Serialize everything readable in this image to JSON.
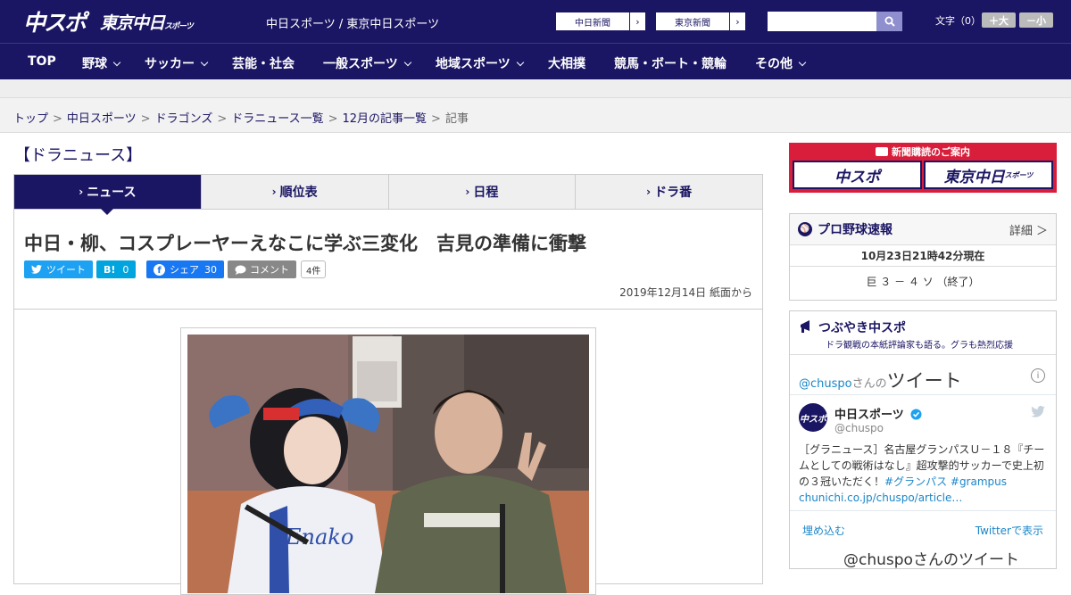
{
  "header": {
    "logo_chuspo": "中スポ",
    "logo_tokyo": "東京中日",
    "logo_tokyo_small": "スポーツ",
    "site_title": "中日スポーツ / 東京中日スポーツ",
    "btn_chunichi": "中日新聞",
    "btn_tokyo": "東京新聞",
    "search_placeholder": "",
    "font_size_label": "文字（0）",
    "font_bigger": "＋大",
    "font_smaller": "－小"
  },
  "nav": {
    "items": [
      {
        "label": "TOP"
      },
      {
        "label": "野球"
      },
      {
        "label": "サッカー"
      },
      {
        "label": "芸能・社会"
      },
      {
        "label": "一般スポーツ"
      },
      {
        "label": "地域スポーツ"
      },
      {
        "label": "大相撲"
      },
      {
        "label": "競馬・ボート・競輪"
      },
      {
        "label": "その他"
      }
    ]
  },
  "breadcrumb": [
    "トップ",
    "中日スポーツ",
    "ドラゴンズ",
    "ドラニュース一覧",
    "12月の記事一覧",
    "記事"
  ],
  "section_title": "【ドラニュース】",
  "tabs": [
    "ニュース",
    "順位表",
    "日程",
    "ドラ番"
  ],
  "article": {
    "headline": "中日・柳、コスプレーヤーえなこに学ぶ三変化　吉見の準備に衝撃",
    "share": {
      "tweet": "ツイート",
      "hatena_label": "B!",
      "hatena_count": "0",
      "fb_share": "シェア",
      "fb_count": "30",
      "comment": "コメント",
      "comment_count": "4件"
    },
    "date": "2019年12月14日 紙面から"
  },
  "sidebar": {
    "ad_title": "新聞購読のご案内",
    "ad_chuspo": "中スポ",
    "ad_tokyo": "東京中日",
    "ad_tokyo_small": "スポーツ",
    "baseball": {
      "title": "プロ野球速報",
      "detail": "詳細 ＞",
      "time": "10月23日21時42分現在",
      "score": "巨 ３ － ４ ソ （終了）"
    },
    "tsubuyaki": {
      "title": "つぶやき中スポ",
      "subtitle": "ドラ観戦の本紙評論家も語る。グラも熱烈応援",
      "handle": "@chuspo",
      "handle_suffix": "さんの",
      "tweet_word": "ツイート",
      "avatar_text": "中スポ",
      "account_name": "中日スポーツ",
      "screen_name": "@chuspo",
      "tweet_text": "［グラニュース］名古屋グランパスＵ－１８『チームとしての戦術はなし』超攻撃的サッカーで史上初の３冠いただく！",
      "tweet_tags": "#グランパス #grampus",
      "tweet_link": "chunichi.co.jp/chuspo/article…",
      "embed": "埋め込む",
      "view_on_twitter": "Twitterで表示",
      "next_tweet": "@chuspoさんのツイート"
    }
  }
}
